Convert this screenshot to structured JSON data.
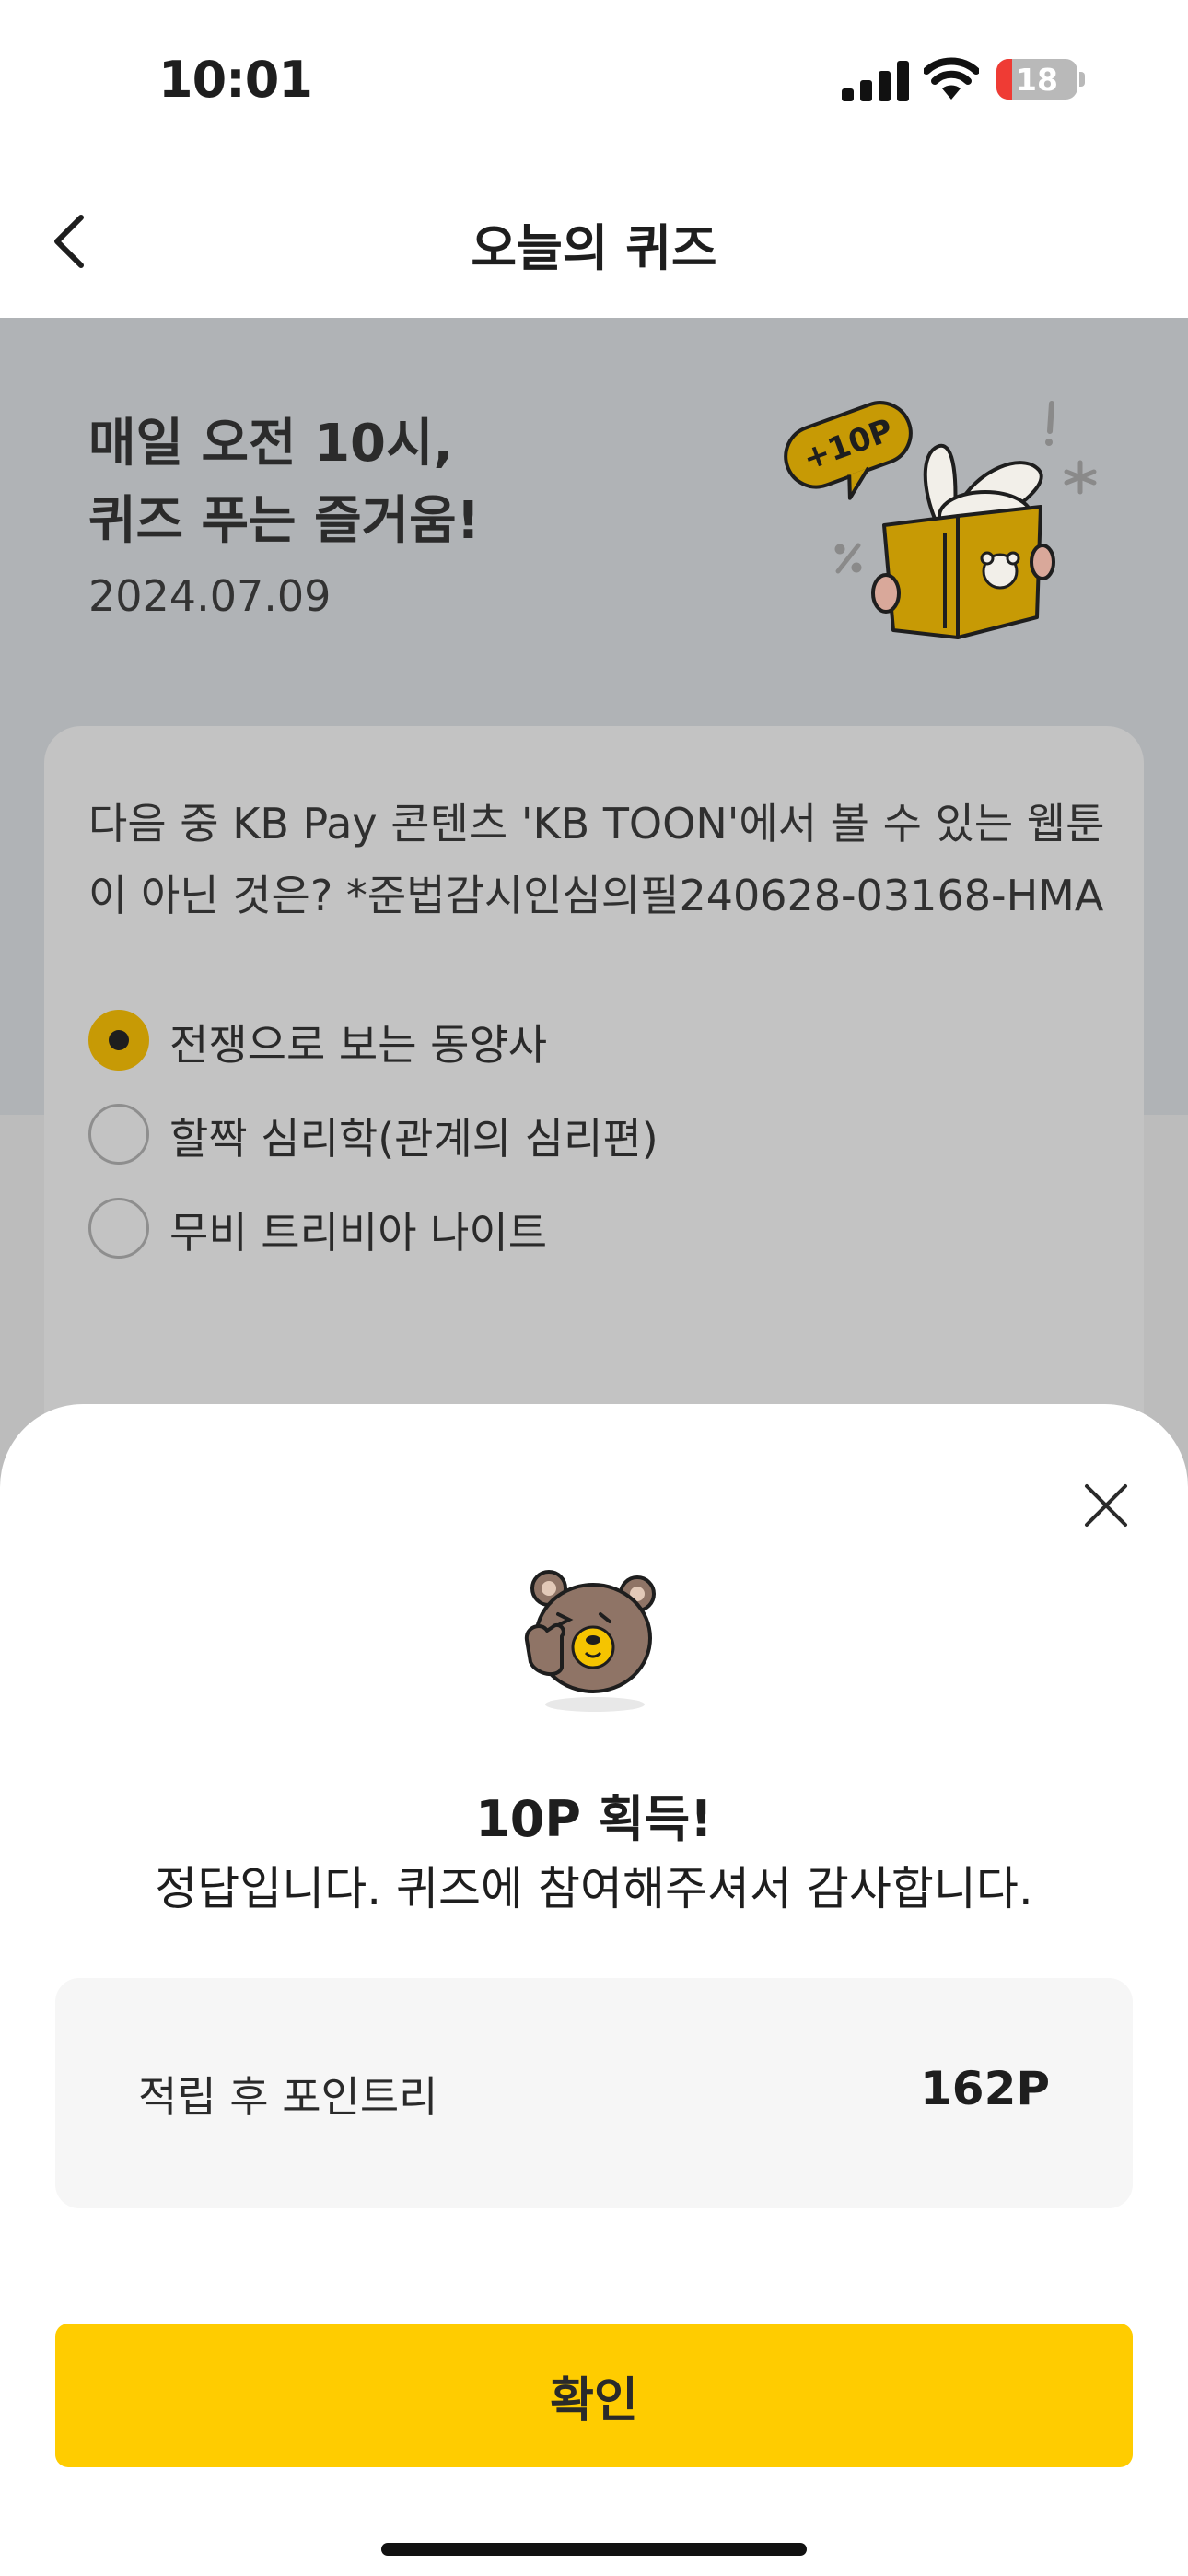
{
  "status_bar": {
    "time": "10:01",
    "battery_level": "18",
    "battery_color": "#ef3b34"
  },
  "nav": {
    "title": "오늘의 퀴즈"
  },
  "hero": {
    "title": "매일 오전 10시,\n퀴즈 푸는 즐거움!",
    "date": "2024.07.09",
    "badge_text": "+10P"
  },
  "quiz": {
    "question": "다음 중 KB Pay 콘텐츠 'KB TOON'에서 볼 수 있는 웹툰이 아닌 것은? *준법감시인심의필240628-03168-HMA",
    "options": [
      {
        "label": "전쟁으로 보는 동양사",
        "selected": true
      },
      {
        "label": "할짝 심리학(관계의 심리편)",
        "selected": false
      },
      {
        "label": "무비 트리비아 나이트",
        "selected": false
      }
    ]
  },
  "result_sheet": {
    "title": "10P 획득!",
    "subtitle": "정답입니다. 퀴즈에 참여해주셔서 감사합니다.",
    "points_label": "적립 후 포인트리",
    "points_value": "162P",
    "confirm_label": "확인"
  },
  "colors": {
    "accent": "#ffcc00",
    "radio_selected": "#c79a05",
    "dim_background": "#b0b3b6"
  },
  "icons": [
    "back-chevron-icon",
    "signal-icon",
    "wifi-icon",
    "battery-icon",
    "close-icon",
    "reading-rabbit-illustration",
    "bear-thumbs-up-illustration"
  ]
}
